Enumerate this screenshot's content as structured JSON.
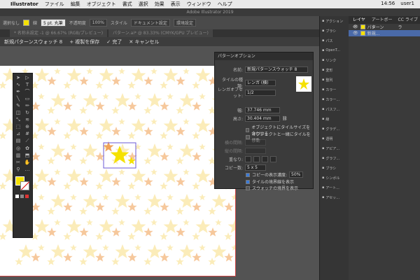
{
  "menubar": {
    "apple": "",
    "app": "Illustrator",
    "items": [
      "ファイル",
      "編集",
      "オブジェクト",
      "書式",
      "選択",
      "効果",
      "表示",
      "ウィンドウ",
      "ヘルプ"
    ],
    "clock": "14:56",
    "user": "user1"
  },
  "window": {
    "title": "Adobe Illustrator 2019"
  },
  "control_bar": {
    "object_kind": "選択なし",
    "stroke_label": "線",
    "brush": "5 pt. 丸筆",
    "opacity_label": "不透明度",
    "opacity": "100%",
    "style_label": "スタイル",
    "doc_setup": "ドキュメント設定",
    "env": "環境設定"
  },
  "doc_tabs": [
    "* 名称未設定 -1 @ 66.67% (RGB/プレビュー)",
    "パターン.ai* @ 83.33% (CMYK/GPU プレビュー)"
  ],
  "pattern_bar": {
    "name": "新規パターンスウォッチ 8",
    "save_copy": "+ 複製を保存",
    "done": "✓ 完了",
    "cancel": "✕ キャンセル"
  },
  "dialog": {
    "title": "パターンオプション",
    "name_label": "名前:",
    "name_value": "新規パターンスウォッチ 8",
    "tile_type_label": "タイルの種類:",
    "tile_type_value": "レンガ (横)",
    "brick_offset_label": "レンガオフセット:",
    "brick_offset_value": "1/2",
    "width_label": "幅:",
    "width_value": "37.746 mm",
    "height_label": "高さ:",
    "height_value": "30.404 mm",
    "opt1": "オブジェクトにタイルサイズを合わせる",
    "opt2": "オブジェクトと一緒にタイルを移動",
    "hspace_label": "横の間隔:",
    "vspace_label": "縦の間隔:",
    "overlap_label": "重なり:",
    "copies_label": "コピー数:",
    "copies_value": "5 x 5",
    "dim_copies": "コピーの表示濃度:",
    "dim_value": "50%",
    "show_tile_edge": "タイルの境界線を表示",
    "show_swatch_bounds": "スウォッチの境界を表示"
  },
  "right_panel": {
    "items": [
      "アクション",
      "ブラシ",
      "パス",
      "OpenT...",
      "リンク",
      "変形",
      "整列",
      "カラー",
      "カラー...",
      "パスフ...",
      "線",
      "グラデ...",
      "透明",
      "アピア...",
      "グラフ...",
      "ブラシ",
      "シンボル",
      "アート...",
      "アセッ..."
    ]
  },
  "layers": {
    "tabs": [
      "レイヤー",
      "アートボード",
      "CC ライブラ"
    ],
    "rows": [
      "パターン",
      "新規..."
    ]
  },
  "colors": {
    "accent": "#3b7bd8",
    "star_yellow": "#f5e100",
    "star_orange": "#f0a35a",
    "star_light": "#f8df8a"
  }
}
